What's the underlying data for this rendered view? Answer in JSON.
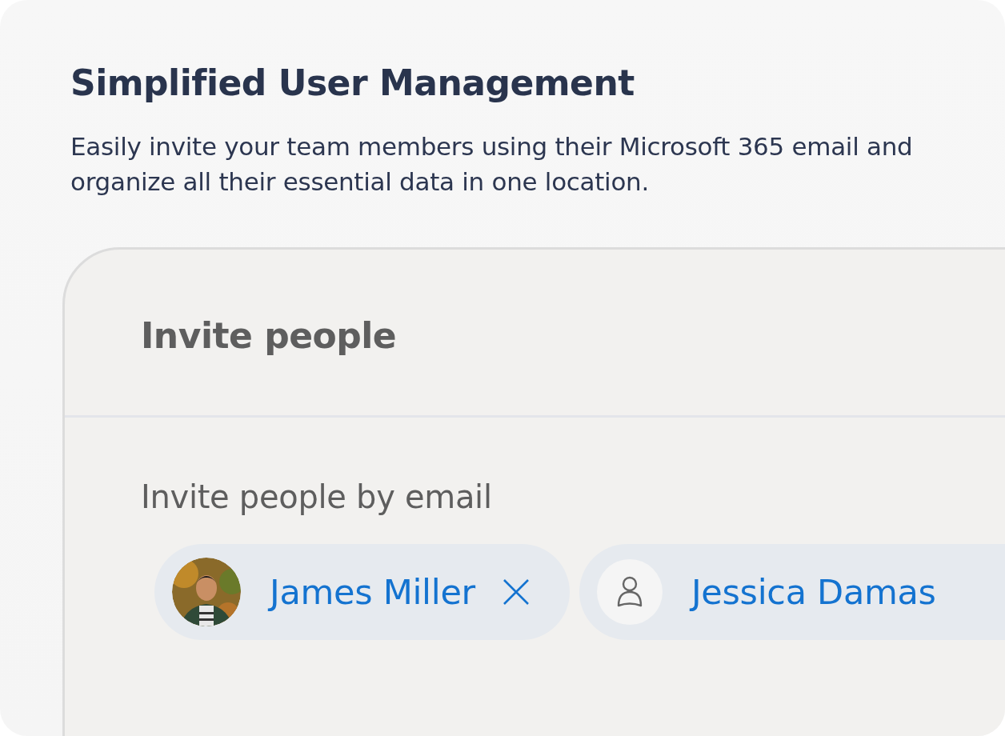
{
  "title": "Simplified User Management",
  "description": "Easily invite your team members using their Microsoft 365 email and organize all their essential data in one location.",
  "panel": {
    "title": "Invite people",
    "field_label": "Invite people by email",
    "chips": [
      {
        "name": "James Miller",
        "removable": true
      },
      {
        "kind": "placeholder",
        "name": "Jessica Damas",
        "removable": false
      }
    ]
  }
}
